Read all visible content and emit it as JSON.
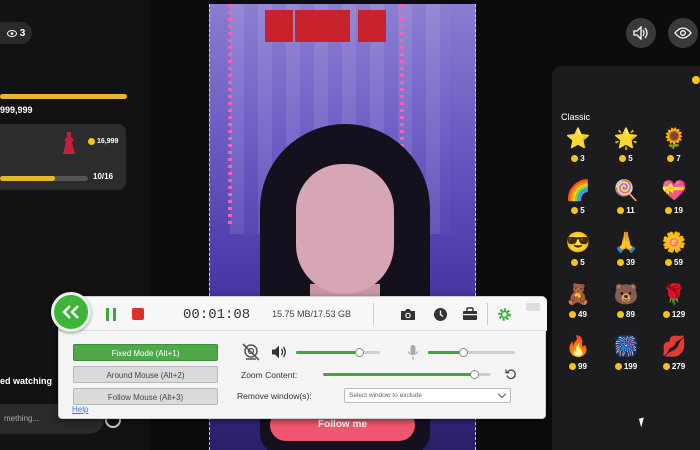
{
  "stream_page": {
    "viewer_count": "3",
    "goal_value": "999,999",
    "goal_progress": 1.0,
    "gift_goal": {
      "price": "16,999",
      "count": "10/16",
      "progress": 0.625
    },
    "watching_text": "ed watching",
    "comment_placeholder": "mething...",
    "follow_label": "Follow me",
    "classic_label": "Classic",
    "gifts": [
      {
        "emoji": "⭐",
        "cost": "3"
      },
      {
        "emoji": "🌟",
        "cost": "5"
      },
      {
        "emoji": "🌻",
        "cost": "7"
      },
      {
        "emoji": "🌈",
        "cost": "5"
      },
      {
        "emoji": "🍭",
        "cost": "11"
      },
      {
        "emoji": "💝",
        "cost": "19"
      },
      {
        "emoji": "😎",
        "cost": "5"
      },
      {
        "emoji": "🙏",
        "cost": "39"
      },
      {
        "emoji": "🌼",
        "cost": "59"
      },
      {
        "emoji": "🧸",
        "cost": "49"
      },
      {
        "emoji": "🐻",
        "cost": "89"
      },
      {
        "emoji": "🌹",
        "cost": "129"
      },
      {
        "emoji": "🔥",
        "cost": "99"
      },
      {
        "emoji": "🎆",
        "cost": "199"
      },
      {
        "emoji": "💋",
        "cost": "279"
      }
    ],
    "icons": {
      "volume": "speaker-icon",
      "visibility": "eye-icon"
    }
  },
  "recorder": {
    "timer": "00:01:08",
    "sizes": "15.75 MB/17.53 GB",
    "modes": [
      {
        "label": "Fixed Mode (Alt+1)",
        "active": true
      },
      {
        "label": "Around Mouse (Alt+2)",
        "active": false
      },
      {
        "label": "Follow Mouse (Alt+3)",
        "active": false
      }
    ],
    "help_label": "Help",
    "zoom_label": "Zoom Content:",
    "remove_label": "Remove window(s):",
    "exclude_placeholder": "Select window to exclude",
    "speaker_level": 0.75,
    "mic_level": 0.4,
    "zoom_level": 0.9,
    "accent_color": "#3fb33a",
    "stop_color": "#e0302a"
  }
}
